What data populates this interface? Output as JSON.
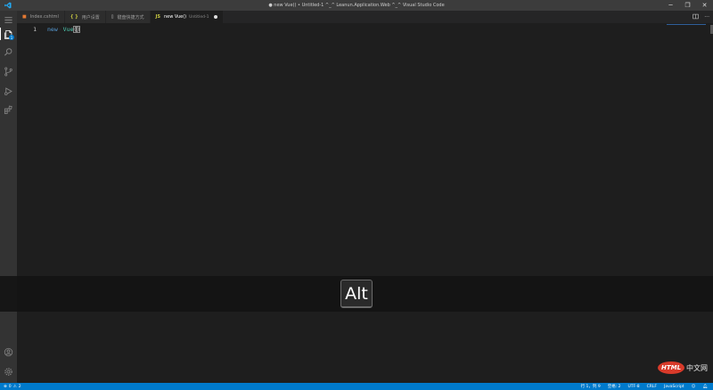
{
  "window": {
    "title": "● new Vue() • Untitled-1 ^_^ Leanun.Application.Web ^_^ Visual Studio Code",
    "controls": [
      "─",
      "❐",
      "✕"
    ]
  },
  "activity_bar": {
    "items": [
      "explorer-icon",
      "search-icon",
      "source-control-icon",
      "debug-icon",
      "extensions-icon"
    ],
    "explorer_badge": "1",
    "bottom": [
      "account-icon",
      "settings-gear-icon"
    ]
  },
  "tabs": [
    {
      "icon": "■",
      "label": "Index.cshtml",
      "color": "#e37933"
    },
    {
      "icon": "{ }",
      "label": "用户设置",
      "color": "#cbcb41"
    },
    {
      "icon": "▯",
      "label": "键盘快捷方式",
      "color": "#cccccc"
    },
    {
      "icon": "JS",
      "label": "new Vue()",
      "desc": "Untitled-1",
      "color": "#cbcb41",
      "active": true,
      "dirty": true
    }
  ],
  "editor_actions": [
    "split-editor-icon",
    "more-actions-icon"
  ],
  "editor": {
    "line_number": "1",
    "keyword": "new",
    "class_name": "Vue",
    "open_paren": "(",
    "close_paren": ")"
  },
  "key_overlay": {
    "key": "Alt"
  },
  "watermark": {
    "logo_text": "HTML",
    "site_text": "中文网"
  },
  "statusbar": {
    "errors": "0",
    "warnings": "2",
    "position": "行 1，列 9",
    "indent": "空格: 2",
    "encoding": "UTF-8",
    "eol": "CRLF",
    "language": "JavaScript"
  },
  "colors": {
    "accent": "#007acc",
    "keyword": "#569cd6",
    "class": "#4ec9b0"
  }
}
